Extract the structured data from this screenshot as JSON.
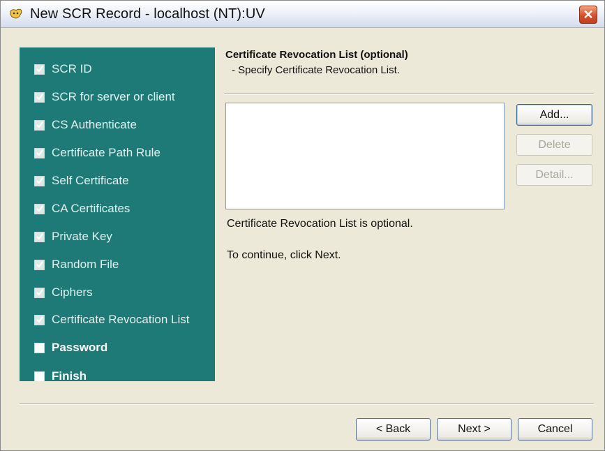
{
  "window": {
    "title": "New SCR Record - localhost (NT):UV",
    "close_label": "✕"
  },
  "steps": [
    {
      "label": "SCR ID",
      "checked": true
    },
    {
      "label": "SCR for server or client",
      "checked": true
    },
    {
      "label": "CS Authenticate",
      "checked": true
    },
    {
      "label": "Certificate Path Rule",
      "checked": true
    },
    {
      "label": "Self Certificate",
      "checked": true
    },
    {
      "label": "CA Certificates",
      "checked": true
    },
    {
      "label": "Private Key",
      "checked": true
    },
    {
      "label": "Random File",
      "checked": true
    },
    {
      "label": "Ciphers",
      "checked": true
    },
    {
      "label": "Certificate Revocation List",
      "checked": true
    },
    {
      "label": "Password",
      "checked": false
    },
    {
      "label": "Finish",
      "checked": false
    }
  ],
  "panel": {
    "title": "Certificate Revocation List (optional)",
    "subtitle": "- Specify Certificate Revocation List.",
    "optional_note": "Certificate Revocation List is optional.",
    "continue_note": "To continue, click Next."
  },
  "list_buttons": {
    "add": "Add...",
    "delete": "Delete",
    "detail": "Detail..."
  },
  "footer": {
    "back": "< Back",
    "next": "Next >",
    "cancel": "Cancel"
  },
  "colors": {
    "steps_panel": "#1d7a76",
    "dialog_bg": "#ece9d8"
  }
}
